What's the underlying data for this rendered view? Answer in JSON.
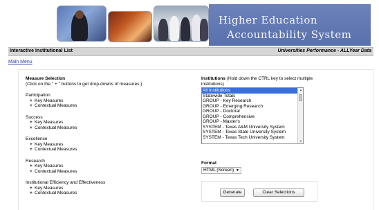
{
  "banner": {
    "title_line1": "Higher Education",
    "title_line2": "Accountability System"
  },
  "header_bar": {
    "left": "Interactive Institutional List",
    "right": "Universities Performance - ALLYear Data"
  },
  "nav": {
    "main_menu": "Main Menu"
  },
  "measure_selection": {
    "heading": "Measure Selection",
    "instruction": "(Click on the \" + \" buttons to get drop-downs of measures.)",
    "groups": [
      {
        "title": "Participation",
        "items": [
          "Key Measures",
          "Contextual Measures"
        ]
      },
      {
        "title": "Success",
        "items": [
          "Key Measures",
          "Contextual Measures"
        ]
      },
      {
        "title": "Excellence",
        "items": [
          "Key Measures",
          "Contextual Measures"
        ]
      },
      {
        "title": "Research",
        "items": [
          "Key Measures",
          "Contextual Measures"
        ]
      },
      {
        "title": "Institutional Efficiency and Effectiveness",
        "items": [
          "Key Measures",
          "Contextual Measures"
        ]
      }
    ]
  },
  "institutions": {
    "heading": "Institutions",
    "hint": "(Hold down the CTRL key to select multiple institutions)",
    "options": [
      "All Institutions",
      "Statewide Totals",
      "GROUP - Key Research",
      "GROUP - Emerging Research",
      "GROUP - Doctoral",
      "GROUP - Comprehensive",
      "GROUP - Master's",
      "SYSTEM - Texas A&M University System",
      "SYSTEM - Texas State University System",
      "SYSTEM - Texas Tech University System"
    ],
    "selected_index": 0
  },
  "format": {
    "label": "Format",
    "selected": "HTML (Screen)"
  },
  "actions": {
    "generate": "Generate",
    "clear": "Clear Selections"
  },
  "colors": {
    "title_panel": "#5f76b2",
    "selection": "#3a6fd8",
    "link": "#2a3fb0"
  }
}
